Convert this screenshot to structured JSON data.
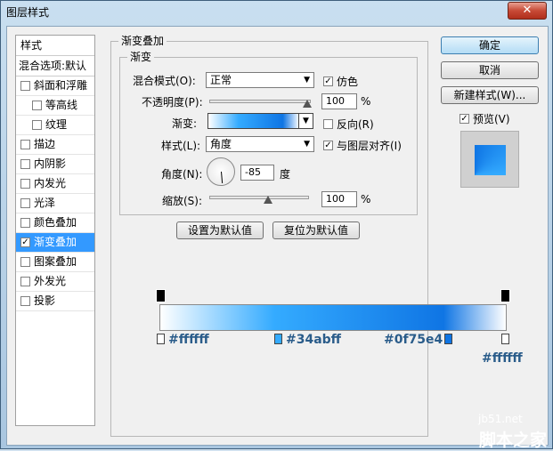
{
  "window": {
    "title": "图层样式",
    "close_label": "✕"
  },
  "left_panel": {
    "header": "样式",
    "blend_options": "混合选项:默认",
    "items": [
      {
        "label": "斜面和浮雕",
        "checked": false,
        "sub": false
      },
      {
        "label": "等高线",
        "checked": false,
        "sub": true
      },
      {
        "label": "纹理",
        "checked": false,
        "sub": true
      },
      {
        "label": "描边",
        "checked": false,
        "sub": false
      },
      {
        "label": "内阴影",
        "checked": false,
        "sub": false
      },
      {
        "label": "内发光",
        "checked": false,
        "sub": false
      },
      {
        "label": "光泽",
        "checked": false,
        "sub": false
      },
      {
        "label": "颜色叠加",
        "checked": false,
        "sub": false
      },
      {
        "label": "渐变叠加",
        "checked": true,
        "sub": false,
        "selected": true
      },
      {
        "label": "图案叠加",
        "checked": false,
        "sub": false
      },
      {
        "label": "外发光",
        "checked": false,
        "sub": false
      },
      {
        "label": "投影",
        "checked": false,
        "sub": false
      }
    ]
  },
  "gradient_overlay": {
    "section_title": "渐变叠加",
    "subsection_title": "渐变",
    "blend_mode_label": "混合模式(O):",
    "blend_mode_value": "正常",
    "dither_label": "仿色",
    "dither_checked": true,
    "opacity_label": "不透明度(P):",
    "opacity_value": "100",
    "opacity_unit": "%",
    "opacity_level": 1.0,
    "gradient_label": "渐变:",
    "reverse_label": "反向(R)",
    "reverse_checked": false,
    "style_label": "样式(L):",
    "style_value": "角度",
    "align_label": "与图层对齐(I)",
    "align_checked": true,
    "angle_label": "角度(N):",
    "angle_value": "-85",
    "angle_unit": "度",
    "scale_label": "缩放(S):",
    "scale_value": "100",
    "scale_unit": "%",
    "scale_level": 0.5,
    "set_default_label": "设置为默认值",
    "reset_default_label": "复位为默认值"
  },
  "buttons": {
    "ok_label": "确定",
    "cancel_label": "取消",
    "new_style_label": "新建样式(W)...",
    "preview_label": "预览(V)",
    "preview_checked": true
  },
  "gradient_stops": {
    "stop1": "#ffffff",
    "stop2": "#34abff",
    "stop3": "#0f75e4",
    "stop4": "#ffffff"
  },
  "colors": {
    "white": "#ffffff",
    "light_blue": "#34abff",
    "dark_blue": "#0f75e4",
    "selection": "#3399ff"
  },
  "watermark": {
    "site": "jb51.net",
    "logo": "脚本之家"
  }
}
